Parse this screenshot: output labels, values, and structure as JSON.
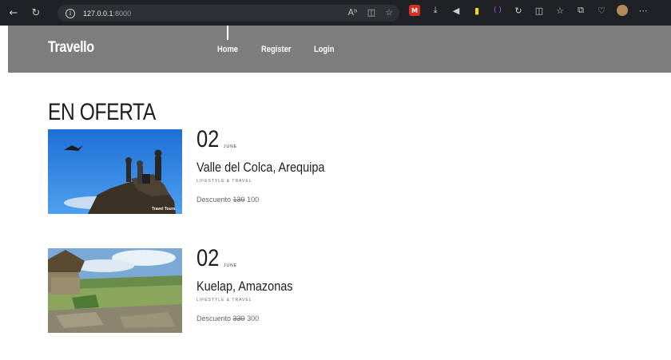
{
  "browser": {
    "url_host": "127.0.0.1",
    "url_port": ":8000",
    "icons": [
      "back-icon",
      "refresh-icon",
      "info-icon",
      "read-aloud-icon",
      "immersive-reader-icon",
      "favorite-icon",
      "extension-icon",
      "download-icon",
      "sound-icon",
      "split-screen-icon",
      "collections-icon",
      "profile-icon",
      "more-icon"
    ]
  },
  "header": {
    "brand": "Travello",
    "nav": [
      "Home",
      "Register",
      "Login"
    ]
  },
  "main": {
    "title": "EN OFERTA",
    "offers": [
      {
        "day": "02",
        "month": "JUNE",
        "place": "Valle del Colca, Arequipa",
        "tag": "LIFESTYLE & TRAVEL",
        "price_label": "Descuento",
        "old_price": "130",
        "new_price": "100",
        "image_watermark": "Travel Tours"
      },
      {
        "day": "02",
        "month": "JUNE",
        "place": "Kuelap, Amazonas",
        "tag": "LIFESTYLE & TRAVEL",
        "price_label": "Descuento",
        "old_price": "330",
        "new_price": "300"
      }
    ]
  }
}
